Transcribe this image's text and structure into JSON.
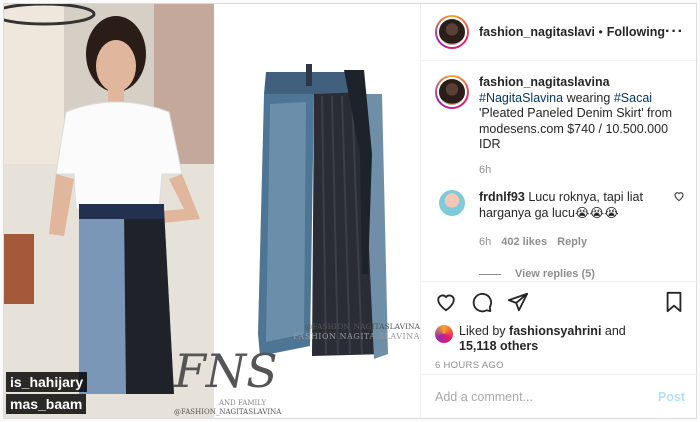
{
  "media": {
    "tags": [
      "is_hahijary",
      "mas_baam"
    ],
    "watermark": {
      "handle_top": "@FASHION_NAGITASLAVINA",
      "brand_line": "FASHION NAGITA SLAVINA",
      "monogram": "FNS",
      "and_family": "AND FAMILY",
      "handle_bottom": "@FASHION_NAGITASLAVINA"
    }
  },
  "header": {
    "username": "fashion_nagitaslavina",
    "separator": "•",
    "follow_label": "Following",
    "more_icon": "ellipsis-icon",
    "more_label": "···"
  },
  "caption": {
    "username": "fashion_nagitaslavina",
    "hashtag1": "#NagitaSlavina",
    "wearing": " wearing ",
    "hashtag2": "#Sacai",
    "rest": "'Pleated Paneled Denim Skirt' from modesens.com $740 / 10.500.000 IDR",
    "time": "6h"
  },
  "comment": {
    "username": "frdnlf93",
    "text": "Lucu roknya, tapi liat harganya ga lucu😭😭😭",
    "time": "6h",
    "likes": "402 likes",
    "reply_label": "Reply",
    "view_replies": "View replies (5)"
  },
  "actions": {
    "icons": [
      "heart-icon",
      "comment-icon",
      "share-icon",
      "bookmark-icon"
    ],
    "liked_prefix": "Liked by ",
    "liked_user": "fashionsyahrini",
    "liked_and": "and",
    "liked_others": "15,118 others",
    "timestamp": "6 HOURS AGO"
  },
  "add_comment": {
    "placeholder": "Add a comment...",
    "post_label": "Post"
  },
  "colors": {
    "link": "#00376b",
    "post_disabled": "#b2dffc",
    "border": "#dbdbdb"
  }
}
